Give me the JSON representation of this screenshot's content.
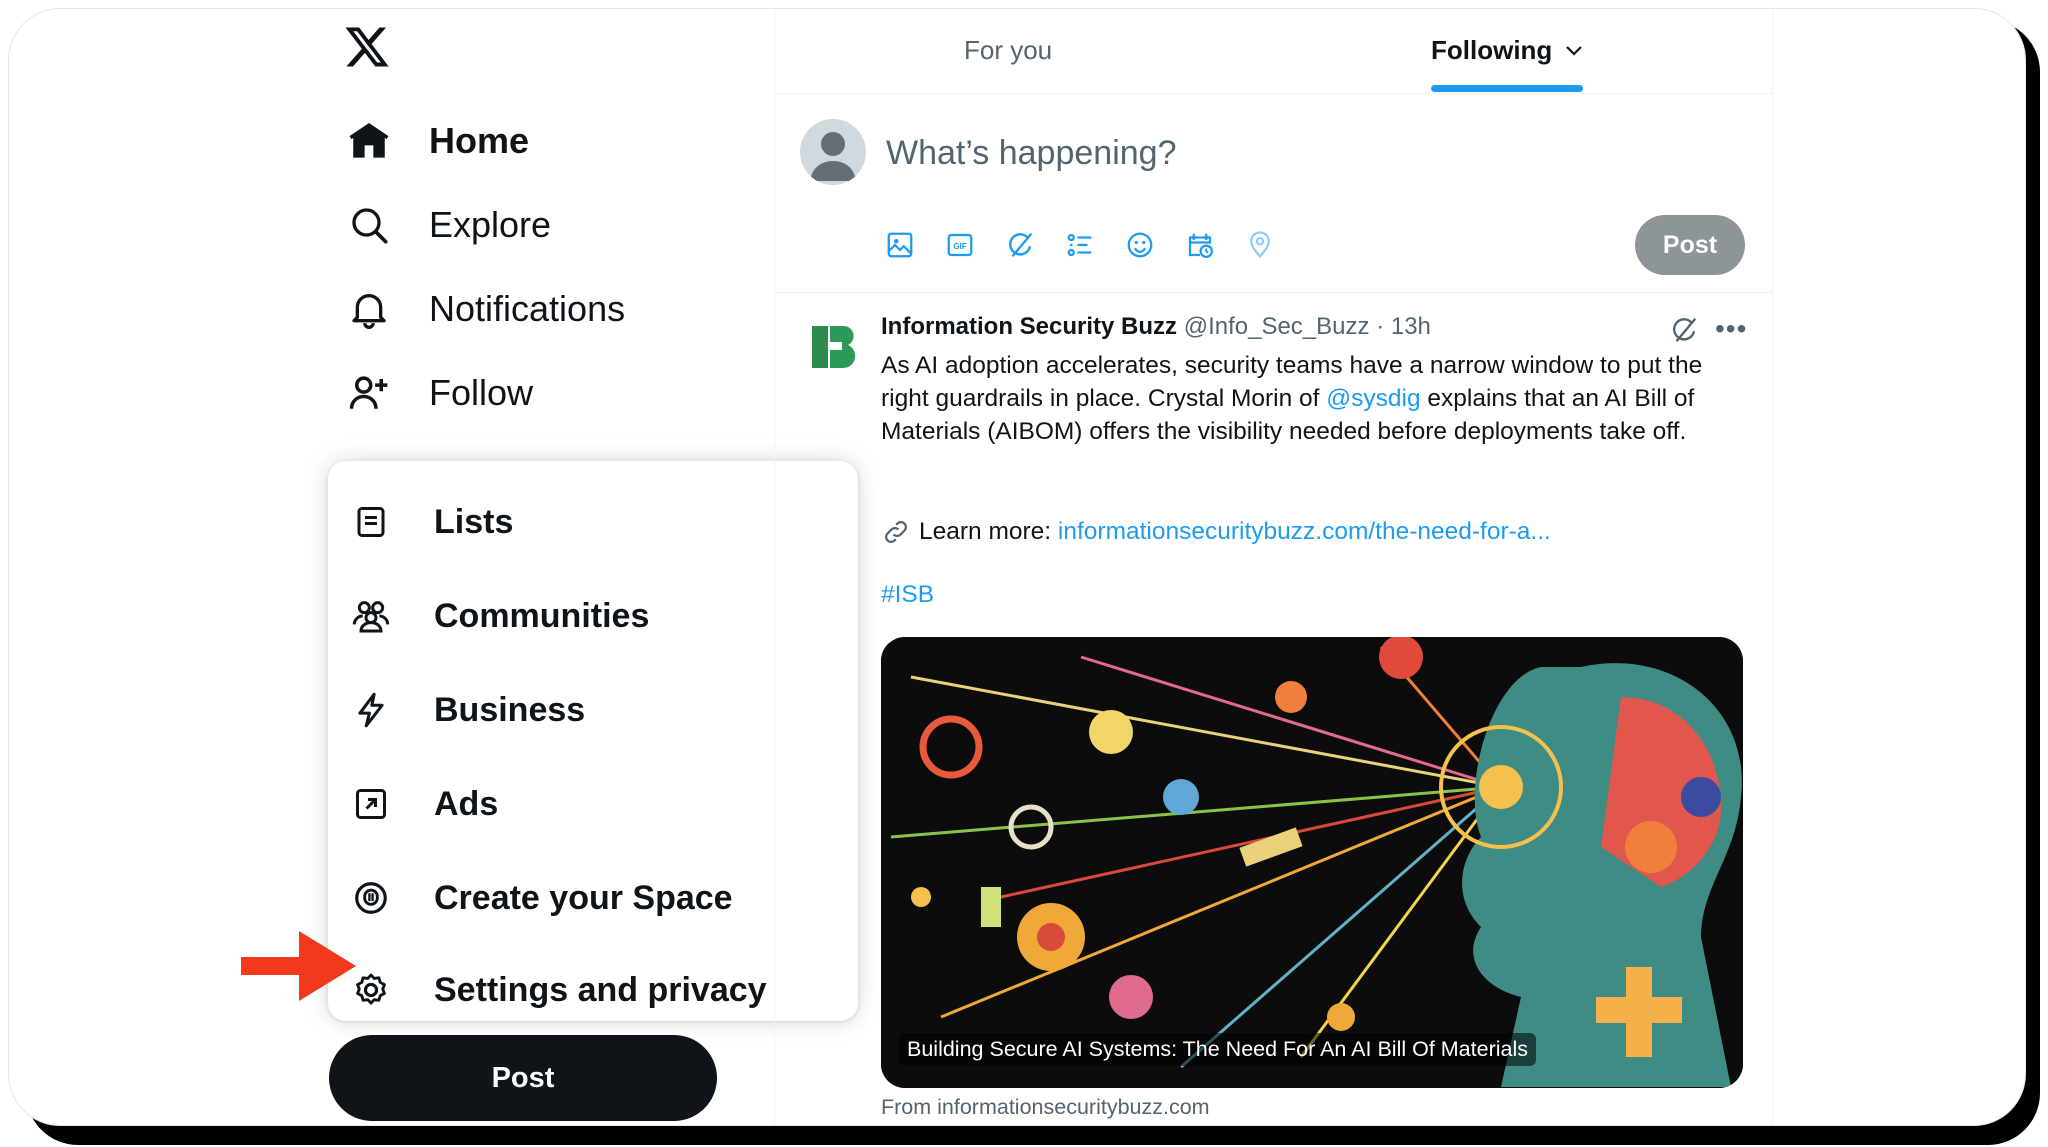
{
  "nav": {
    "items": [
      {
        "label": "Home",
        "icon": "home-icon",
        "active": true
      },
      {
        "label": "Explore",
        "icon": "search-icon"
      },
      {
        "label": "Notifications",
        "icon": "bell-icon"
      },
      {
        "label": "Follow",
        "icon": "person-add-icon"
      }
    ],
    "post_label": "Post"
  },
  "more_menu": {
    "items": [
      {
        "label": "Lists",
        "icon": "list-icon"
      },
      {
        "label": "Communities",
        "icon": "communities-icon"
      },
      {
        "label": "Business",
        "icon": "lightning-icon"
      },
      {
        "label": "Ads",
        "icon": "ads-icon"
      },
      {
        "label": "Create your Space",
        "icon": "spaces-icon"
      },
      {
        "label": "Settings and privacy",
        "icon": "gear-icon"
      }
    ]
  },
  "annotation": {
    "arrow_color": "#f2391b"
  },
  "timeline": {
    "tabs": [
      {
        "label": "For you"
      },
      {
        "label": "Following",
        "active": true
      }
    ],
    "accent": "#1d9bf0"
  },
  "composer": {
    "placeholder": "What’s happening?",
    "post_label": "Post",
    "tools": [
      "image-icon",
      "gif-icon",
      "grok-icon",
      "poll-icon",
      "emoji-icon",
      "schedule-icon",
      "location-icon"
    ]
  },
  "tweet": {
    "author": "Information Security Buzz",
    "handle": "@Info_Sec_Buzz",
    "separator": "·",
    "time": "13h",
    "text_1": "As AI adoption accelerates, security teams have a narrow window to put the right guardrails in place. Crystal Morin of ",
    "mention": "@sysdig",
    "text_2": " explains that an AI Bill of Materials (AIBOM) offers the visibility needed before deployments take off.",
    "learn_label": "Learn more:",
    "learn_link": "informationsecuritybuzz.com/the-need-for-a...",
    "hashtag": "#ISB",
    "card_caption": "Building Secure AI Systems: The Need For An AI Bill Of Materials",
    "card_from": "From informationsecuritybuzz.com"
  }
}
